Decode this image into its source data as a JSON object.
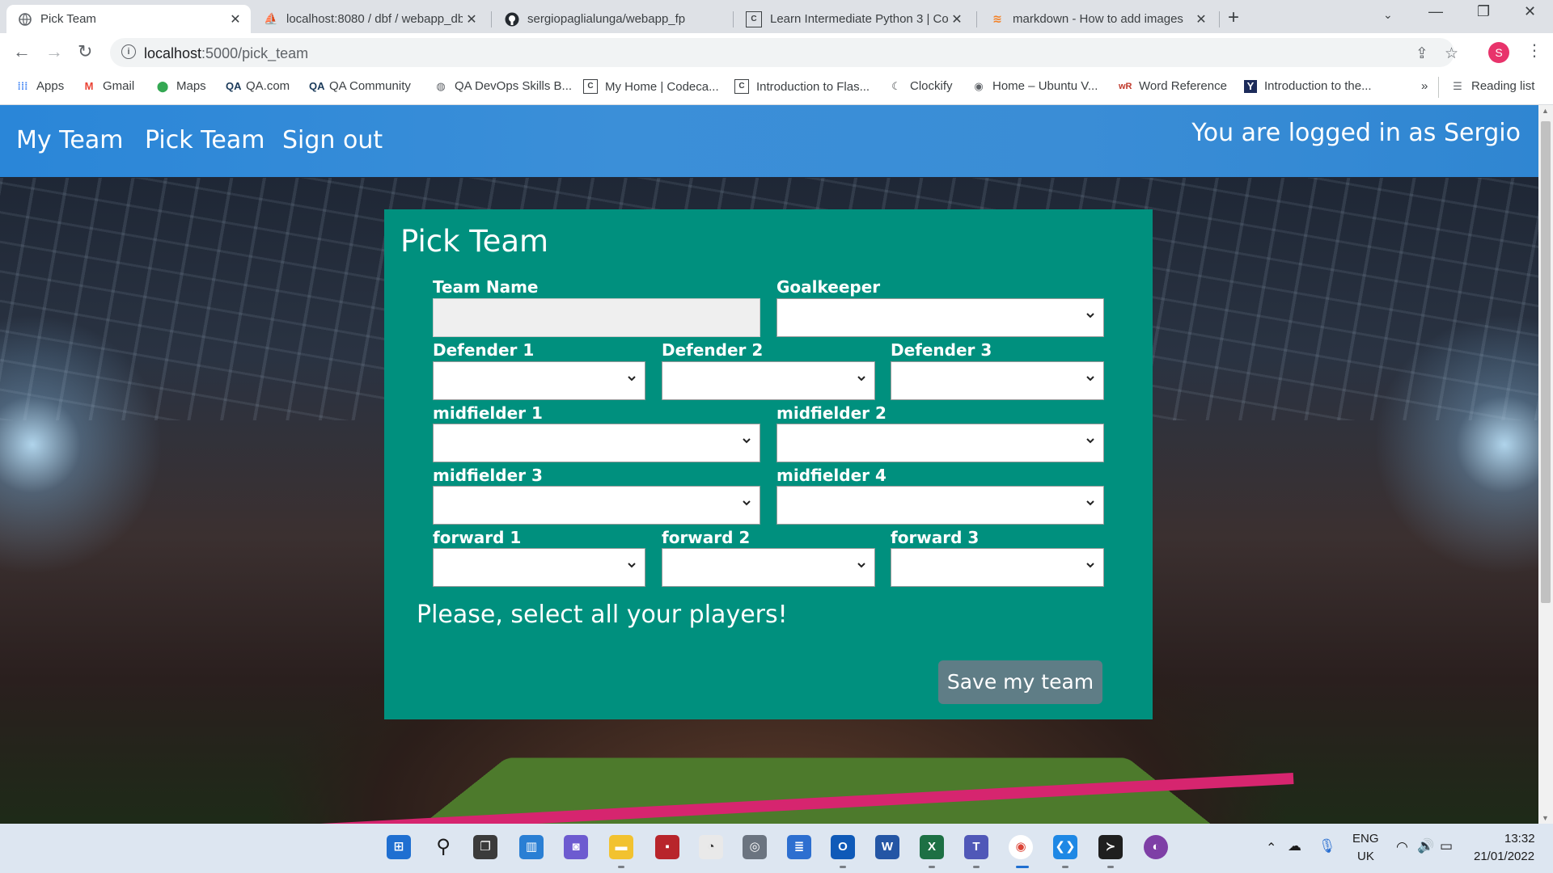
{
  "browser": {
    "tabs": [
      {
        "title": "Pick Team",
        "icon": "globe-icon"
      },
      {
        "title": "localhost:8080 / dbf / webapp_db",
        "icon": "phpmyadmin-icon"
      },
      {
        "title": "sergiopaglialunga/webapp_fp",
        "icon": "github-icon"
      },
      {
        "title": "Learn Intermediate Python 3 | Co",
        "icon": "codecademy-icon"
      },
      {
        "title": "markdown - How to add images",
        "icon": "stackoverflow-icon"
      }
    ],
    "url_host": "localhost",
    "url_path": ":5000/pick_team",
    "profile_initial": "S",
    "bookmarks": [
      "Apps",
      "Gmail",
      "Maps",
      "QA.com",
      "QA Community",
      "QA DevOps Skills B...",
      "My Home | Codeca...",
      "Introduction to Flas...",
      "Clockify",
      "Home – Ubuntu V...",
      "Word Reference",
      "Introduction to the..."
    ],
    "more_bookmarks": "»",
    "reading_list": "Reading list"
  },
  "nav": {
    "my_team": "My Team",
    "pick_team": "Pick Team",
    "sign_out": "Sign out",
    "logged_in": "You are logged in as Sergio"
  },
  "form": {
    "title": "Pick Team",
    "team_name_label": "Team Name",
    "goalkeeper_label": "Goalkeeper",
    "defender1_label": "Defender 1",
    "defender2_label": "Defender 2",
    "defender3_label": "Defender 3",
    "midfielder1_label": "midfielder 1",
    "midfielder2_label": "midfielder 2",
    "midfielder3_label": "midfielder 3",
    "midfielder4_label": "midfielder 4",
    "forward1_label": "forward 1",
    "forward2_label": "forward 2",
    "forward3_label": "forward 3",
    "message": "Please, select all your players!",
    "save_label": "Save my team"
  },
  "taskbar": {
    "language": "ENG",
    "region": "UK",
    "time": "13:32",
    "date": "21/01/2022"
  }
}
